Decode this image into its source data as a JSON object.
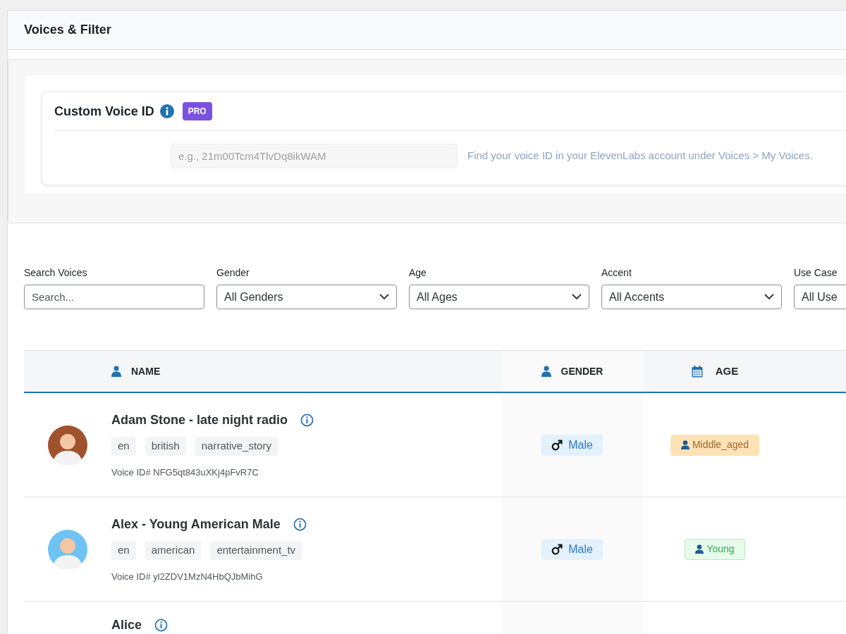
{
  "page": {
    "title": "Voices & Filter"
  },
  "custom_voice": {
    "title": "Custom Voice ID",
    "badge": "PRO",
    "placeholder": "e.g., 21m00Tcm4TlvDq8ikWAM",
    "help": "Find your voice ID in your ElevenLabs account under Voices > My Voices."
  },
  "filters": [
    {
      "kind": "search",
      "label": "Search Voices",
      "placeholder": "Search..."
    },
    {
      "kind": "select",
      "label": "Gender",
      "value": "All Genders"
    },
    {
      "kind": "select",
      "label": "Age",
      "value": "All Ages"
    },
    {
      "kind": "select",
      "label": "Accent",
      "value": "All Accents"
    },
    {
      "kind": "select_partial",
      "label": "Use Case",
      "value": "All Use"
    }
  ],
  "table": {
    "columns": [
      {
        "kind": "person",
        "label": "NAME"
      },
      {
        "kind": "person",
        "label": "GENDER"
      },
      {
        "kind": "calendar",
        "label": "AGE"
      }
    ],
    "rows": [
      {
        "name": "Adam Stone - late night radio",
        "color": "#a0522d",
        "tags": [
          "en",
          "british",
          "narrative_story"
        ],
        "voice_id": "Voice ID# NFG5qt843uXKj4pFvR7C",
        "gender": "Male",
        "age": {
          "label": "Middle_aged",
          "color": "#fde2b6"
        }
      },
      {
        "name": "Alex - Young American Male",
        "color": "#6ec3f4",
        "tags": [
          "en",
          "american",
          "entertainment_tv"
        ],
        "voice_id": "Voice ID# yl2ZDV1MzN4HbQJbMihG",
        "gender": "Male",
        "age": {
          "label": "Young",
          "color": "#e6fbe9"
        }
      },
      {
        "name": "Alice"
      }
    ]
  }
}
